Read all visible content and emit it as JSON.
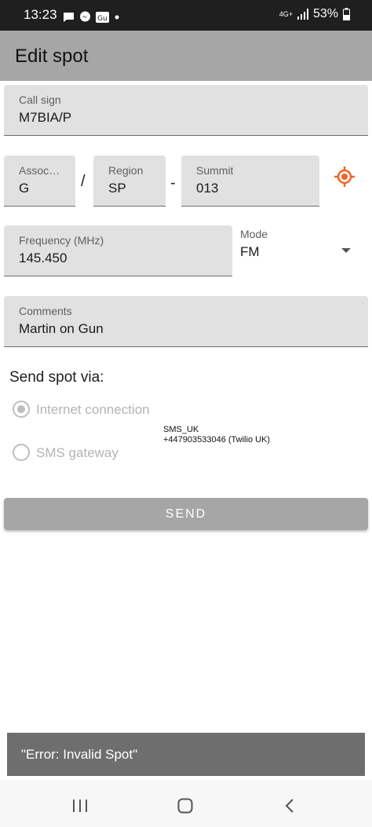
{
  "status_bar": {
    "time": "13:23",
    "notification_icons": [
      "chat-icon",
      "messenger-icon",
      "news-icon",
      "dot-icon"
    ],
    "network": "4G+",
    "battery": "53%"
  },
  "app_bar": {
    "title": "Edit spot"
  },
  "form": {
    "callsign": {
      "label": "Call sign",
      "value": "M7BIA/P"
    },
    "association": {
      "label": "Assoc…",
      "value": "G"
    },
    "slash": "/",
    "region": {
      "label": "Region",
      "value": "SP"
    },
    "dash": "-",
    "summit": {
      "label": "Summit",
      "value": "013"
    },
    "frequency": {
      "label": "Frequency (MHz)",
      "value": "145.450"
    },
    "mode": {
      "label": "Mode",
      "value": "FM"
    },
    "comments": {
      "label": "Comments",
      "value": "Martin on Gun"
    }
  },
  "send_via": {
    "heading": "Send spot via:",
    "options": [
      {
        "label": "Internet connection",
        "selected": true
      },
      {
        "label": "SMS gateway",
        "selected": false
      }
    ],
    "sms_info": {
      "name": "SMS_UK",
      "number": "+447903533046 (Twilio UK)"
    }
  },
  "send_button": {
    "label": "SEND"
  },
  "snackbar": {
    "message": "\"Error: Invalid Spot\""
  },
  "colors": {
    "accent": "#f26522",
    "appbar": "#a6a6a6"
  }
}
